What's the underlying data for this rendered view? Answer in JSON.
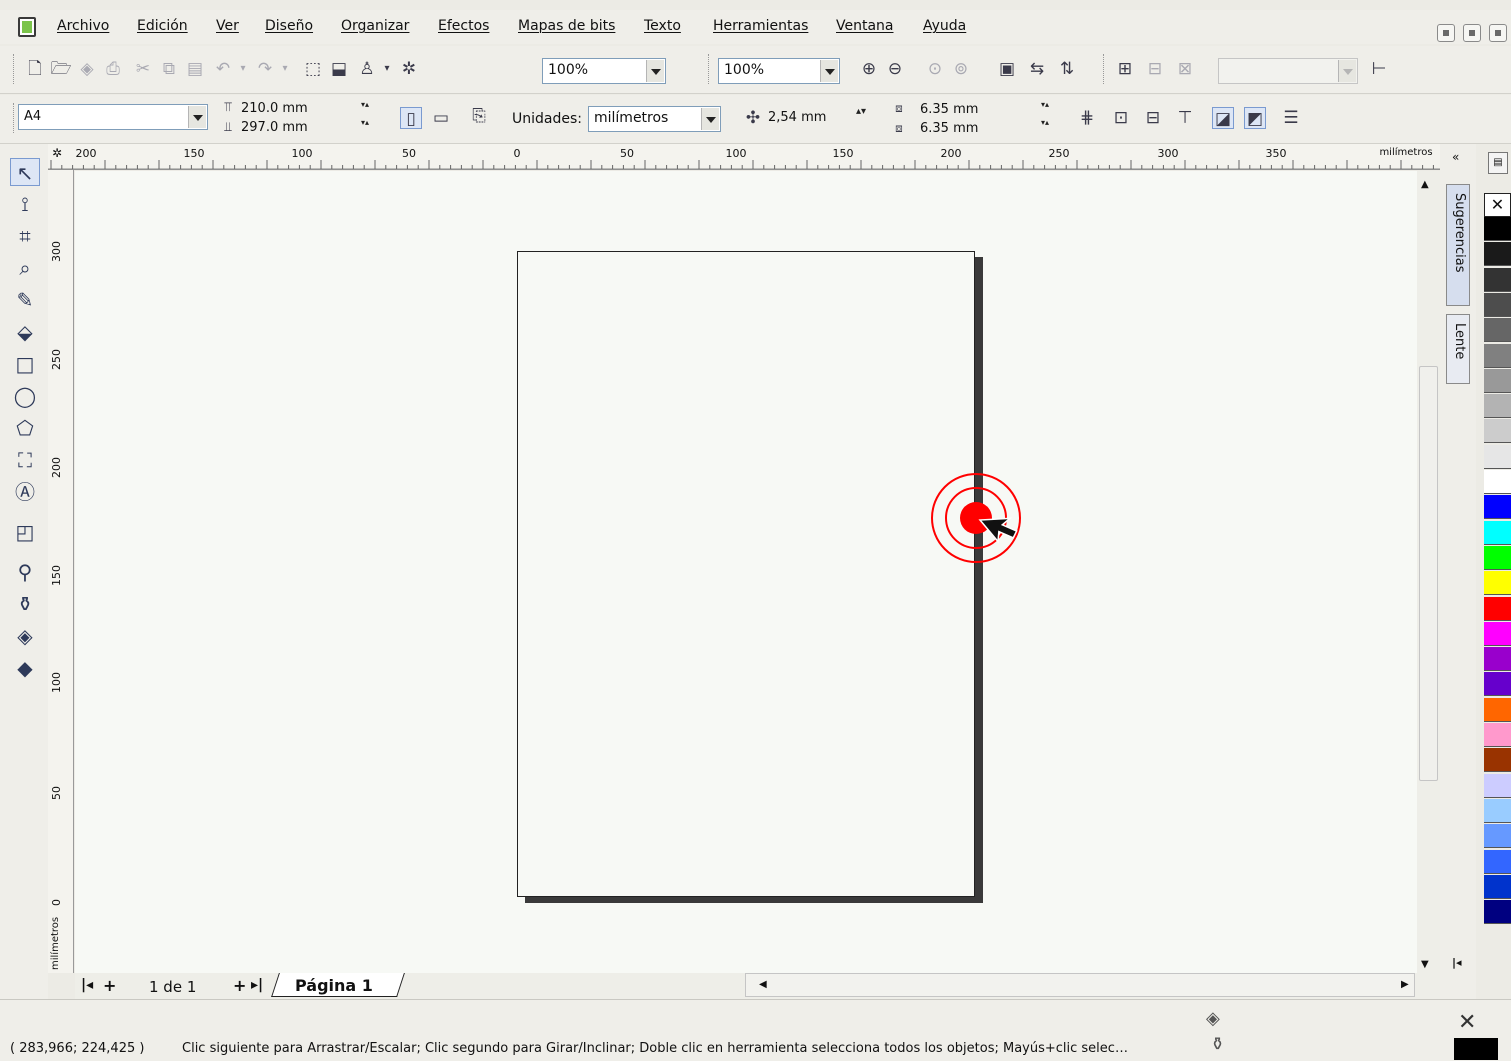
{
  "menu": {
    "items": [
      "Archivo",
      "Edición",
      "Ver",
      "Diseño",
      "Organizar",
      "Efectos",
      "Mapas de bits",
      "Texto",
      "Herramientas",
      "Ventana",
      "Ayuda"
    ]
  },
  "toolbar": {
    "zoom_left": "100%",
    "zoom_right": "100%"
  },
  "property_bar": {
    "paper_size": "A4",
    "width": "210.0 mm",
    "height": "297.0 mm",
    "units_label": "Unidades:",
    "units_value": "milímetros",
    "nudge": "2,54 mm",
    "dup_x": "6.35 mm",
    "dup_y": "6.35 mm"
  },
  "ruler": {
    "h_labels": [
      "200",
      "150",
      "100",
      "50",
      "0",
      "50",
      "100",
      "150",
      "200",
      "250",
      "300",
      "350"
    ],
    "h_unit": "milímetros",
    "v_labels": [
      "300",
      "250",
      "200",
      "150",
      "100",
      "50",
      "0"
    ],
    "v_unit": "milímetros"
  },
  "pages": {
    "counter": "1 de 1",
    "tab": "Página 1"
  },
  "dockers": {
    "tab1": "Sugerencias",
    "tab2": "Lente"
  },
  "palette": [
    "#ffffff",
    "#000000",
    "#1a1a1a",
    "#333333",
    "#4d4d4d",
    "#666666",
    "#808080",
    "#999999",
    "#b3b3b3",
    "#cccccc",
    "#e6e6e6",
    "#ffffff",
    "#0000ff",
    "#00ffff",
    "#00ff00",
    "#ffff00",
    "#ff0000",
    "#ff00ff",
    "#9900cc",
    "#6600cc",
    "#ff6600",
    "#ff99cc",
    "#993300",
    "#ccccff",
    "#99ccff",
    "#6699ff",
    "#3366ff",
    "#0033cc",
    "#000080"
  ],
  "status": {
    "coords": "( 283,966; 224,425 )",
    "message": "Clic siguiente para Arrastrar/Escalar; Clic segundo para Girar/Inclinar; Doble clic en herramienta selecciona todos los objetos; Mayús+clic selec…"
  },
  "colors": {
    "click_marker": "#ff0000"
  }
}
